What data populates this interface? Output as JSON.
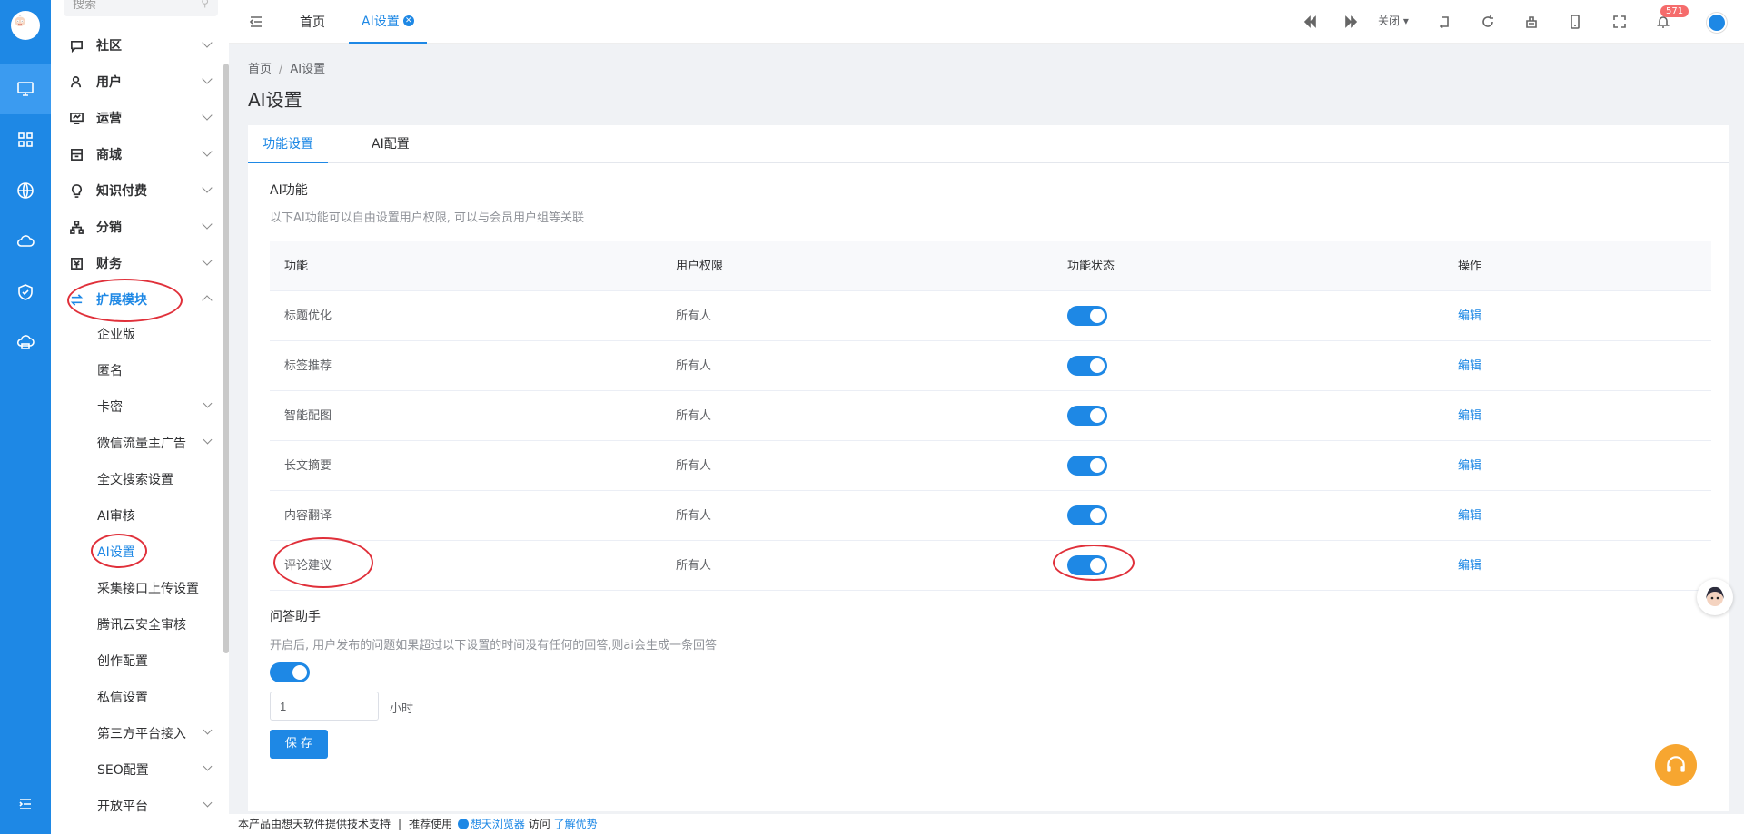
{
  "sidebar": {
    "search_placeholder": "搜索",
    "menu": [
      {
        "label": "社区"
      },
      {
        "label": "用户"
      },
      {
        "label": "运营"
      },
      {
        "label": "商城"
      },
      {
        "label": "知识付费"
      },
      {
        "label": "分销"
      },
      {
        "label": "财务"
      },
      {
        "label": "扩展模块"
      }
    ],
    "submenu": [
      {
        "label": "企业版"
      },
      {
        "label": "匿名"
      },
      {
        "label": "卡密"
      },
      {
        "label": "微信流量主广告"
      },
      {
        "label": "全文搜索设置"
      },
      {
        "label": "AI审核"
      },
      {
        "label": "AI设置"
      },
      {
        "label": "采集接口上传设置"
      },
      {
        "label": "腾讯云安全审核"
      },
      {
        "label": "创作配置"
      },
      {
        "label": "私信设置"
      },
      {
        "label": "第三方平台接入"
      },
      {
        "label": "SEO配置"
      },
      {
        "label": "开放平台"
      }
    ]
  },
  "topbar": {
    "tabs": [
      {
        "label": "首页"
      },
      {
        "label": "AI设置"
      }
    ],
    "close_label": "关闭",
    "badge_count": "571"
  },
  "breadcrumb": {
    "home": "首页",
    "sep": "/",
    "current": "AI设置"
  },
  "page_title": "AI设置",
  "content_tabs": [
    {
      "label": "功能设置"
    },
    {
      "label": "AI配置"
    }
  ],
  "ai_section": {
    "title": "AI功能",
    "desc": "以下AI功能可以自由设置用户权限, 可以与会员用户组等关联",
    "columns": [
      "功能",
      "用户权限",
      "功能状态",
      "操作"
    ],
    "rows": [
      {
        "name": "标题优化",
        "perm": "所有人",
        "enabled": true,
        "action": "编辑"
      },
      {
        "name": "标签推荐",
        "perm": "所有人",
        "enabled": true,
        "action": "编辑"
      },
      {
        "name": "智能配图",
        "perm": "所有人",
        "enabled": true,
        "action": "编辑"
      },
      {
        "name": "长文摘要",
        "perm": "所有人",
        "enabled": true,
        "action": "编辑"
      },
      {
        "name": "内容翻译",
        "perm": "所有人",
        "enabled": true,
        "action": "编辑"
      },
      {
        "name": "评论建议",
        "perm": "所有人",
        "enabled": true,
        "action": "编辑"
      }
    ]
  },
  "qa_section": {
    "title": "问答助手",
    "desc": "开启后, 用户发布的问题如果超过以下设置的时间没有任何的回答,则ai会生成一条回答",
    "enabled": true,
    "hours_value": "1",
    "unit": "小时",
    "save_label": "保 存"
  },
  "footer": {
    "text1": "本产品由想天软件提供技术支持",
    "sep": "|",
    "text2": "推荐使用",
    "browser": "想天浏览器",
    "text3": "访问",
    "link": "了解优势"
  },
  "colors": {
    "primary": "#1e88e5",
    "annotation": "#e0303a",
    "badge": "#f56c6c"
  }
}
